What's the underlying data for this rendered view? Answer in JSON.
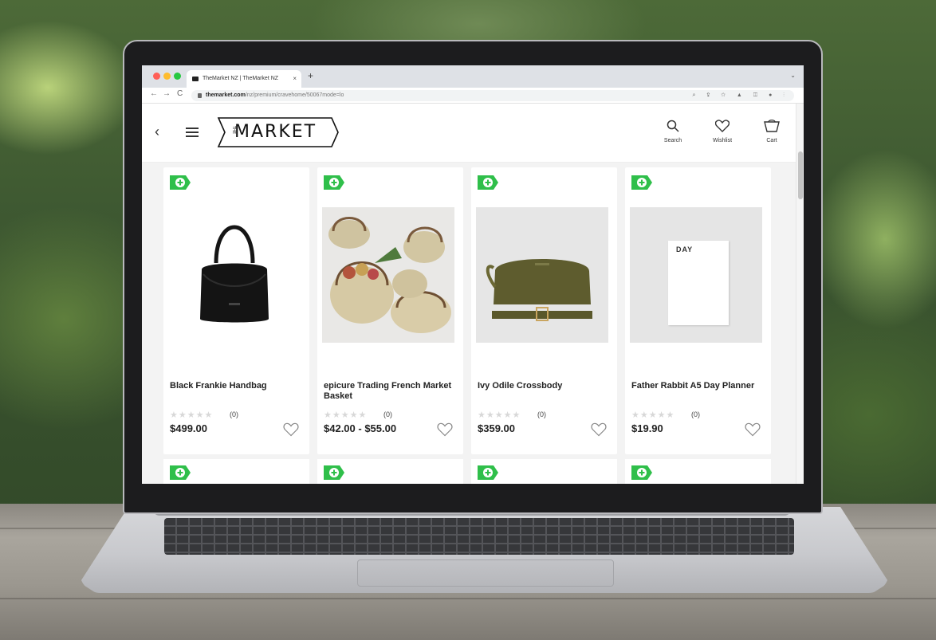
{
  "browser": {
    "tab_title": "TheMarket NZ | TheMarket NZ",
    "tab_close": "×",
    "new_tab": "+",
    "tab_menu": "⌄",
    "back": "←",
    "forward": "→",
    "reload": "C",
    "url_host": "themarket.com",
    "url_path": "/nz/premium/cravehome/50067mode=lo",
    "toolbar_icons": "⌕ ⇪ ☆ ▲ ◫ ● ⋮"
  },
  "site": {
    "logo": "THE MARKET",
    "logo_text": "MARKET",
    "logo_the": "THE",
    "back_icon": "‹",
    "actions": {
      "search_label": "Search",
      "wishlist_label": "Wishlist",
      "cart_label": "Cart"
    }
  },
  "colors": {
    "tag_green": "#2fbf4a",
    "price_text": "#222222"
  },
  "products": [
    {
      "title": "Black Frankie Handbag",
      "rating_count": "(0)",
      "price": "$499.00"
    },
    {
      "title": "epicure Trading French Market Basket",
      "rating_count": "(0)",
      "price": "$42.00 - $55.00"
    },
    {
      "title": "Ivy Odile Crossbody",
      "rating_count": "(0)",
      "price": "$359.00"
    },
    {
      "title": "Father Rabbit A5 Day Planner",
      "rating_count": "(0)",
      "price": "$19.90"
    }
  ],
  "planner_cover_text": "DAY",
  "stars": "★★★★★"
}
